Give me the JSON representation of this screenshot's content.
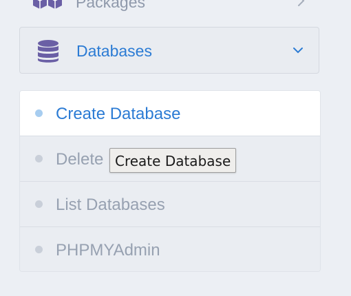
{
  "nav": {
    "packages": {
      "label": "Packages",
      "icon": "cubes-icon"
    },
    "databases": {
      "label": "Databases",
      "icon": "database-icon",
      "expanded": true,
      "items": [
        {
          "label": "Create Database",
          "active": true
        },
        {
          "label": "Delete Database",
          "active": false
        },
        {
          "label": "List Databases",
          "active": false
        },
        {
          "label": "PHPMYAdmin",
          "active": false
        }
      ]
    }
  },
  "tooltip": {
    "text": "Create Database"
  },
  "colors": {
    "accent": "#2b7bd4",
    "icon": "#6a5fa5",
    "muted_text": "#97a1b1",
    "background": "#eceff4"
  }
}
